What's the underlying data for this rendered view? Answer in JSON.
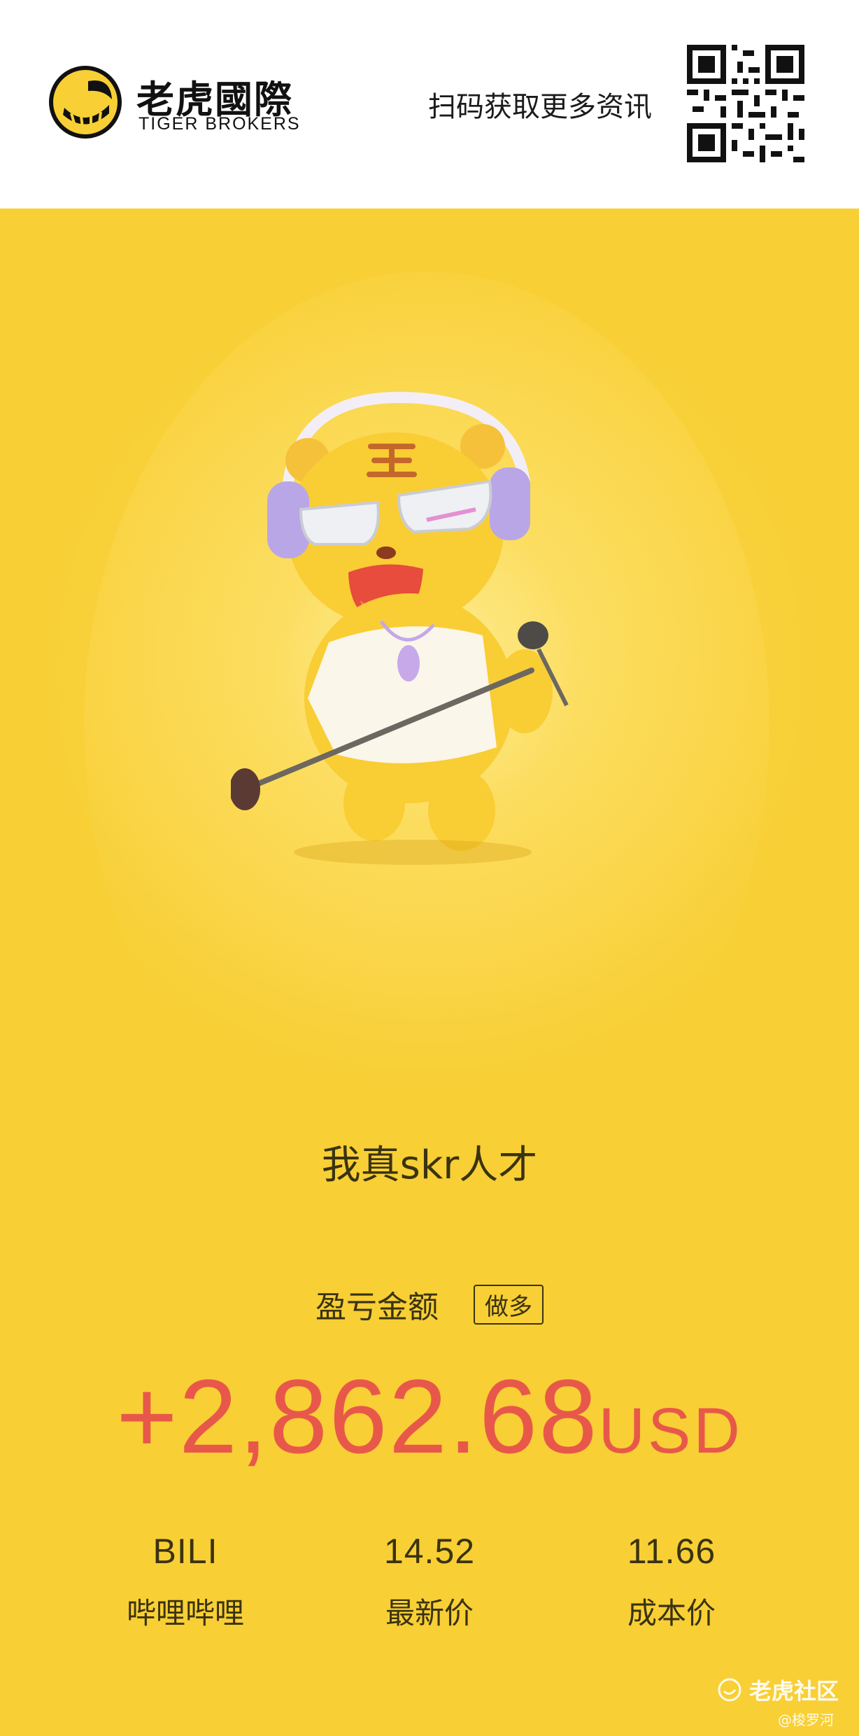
{
  "header": {
    "brand_cn": "老虎國際",
    "brand_en": "TIGER BROKERS",
    "scan_text": "扫码获取更多资讯",
    "logo_icon": "tiger-logo-icon",
    "qr_icon": "qr-code-icon"
  },
  "card": {
    "mascot_icon": "tiger-mascot-with-microphone",
    "slogan": "我真skr人才",
    "pl_label": "盈亏金额",
    "direction": "做多",
    "amount": "+2,862.68",
    "currency": "USD",
    "stats": [
      {
        "value": "BILI",
        "label": "哔哩哔哩"
      },
      {
        "value": "14.52",
        "label": "最新价"
      },
      {
        "value": "11.66",
        "label": "成本价"
      }
    ]
  },
  "watermark": {
    "text": "老虎社区",
    "user": "@梭罗河"
  },
  "colors": {
    "background": "#f8cf35",
    "profit": "#e8584a",
    "text": "#3a3310"
  }
}
